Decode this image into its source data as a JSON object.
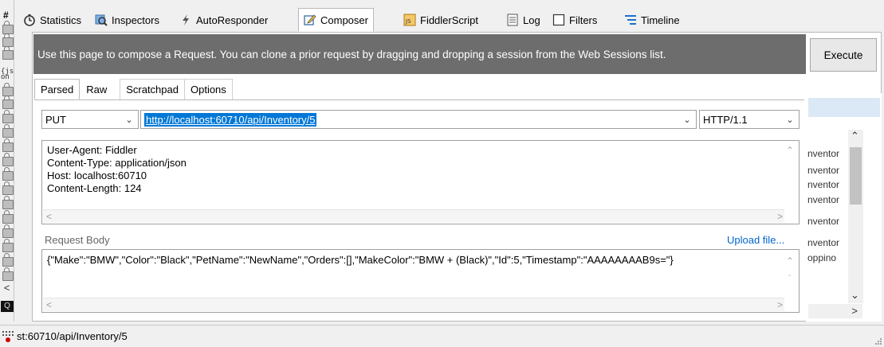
{
  "tabbar": {
    "hash": "#",
    "tabs": [
      {
        "label": "Statistics",
        "icon": "stopwatch-icon"
      },
      {
        "label": "Inspectors",
        "icon": "inspectors-icon"
      },
      {
        "label": "AutoResponder",
        "icon": "lightning-icon"
      },
      {
        "label": "Composer",
        "icon": "composer-pencil-icon",
        "active": true
      },
      {
        "label": "FiddlerScript",
        "icon": "js-script-icon"
      },
      {
        "label": "Log",
        "icon": "log-icon"
      },
      {
        "label": "Filters",
        "icon": "checkbox-icon"
      },
      {
        "label": "Timeline",
        "icon": "timeline-icon"
      }
    ]
  },
  "composer": {
    "banner": "Use this page to compose a Request. You can clone a prior request by dragging and dropping a session from the Web Sessions list.",
    "execute_label": "Execute",
    "subtabs": [
      "Parsed",
      "Raw",
      "Scratchpad",
      "Options"
    ],
    "method": "PUT",
    "url": "http://localhost:60710/api/Inventory/5",
    "http_version": "HTTP/1.1",
    "headers": [
      "User-Agent: Fiddler",
      "Content-Type: application/json",
      "Host: localhost:60710",
      "Content-Length: 124"
    ],
    "request_body_label": "Request Body",
    "upload_label": "Upload file...",
    "body": "{\"Make\":\"BMW\",\"Color\":\"Black\",\"PetName\":\"NewName\",\"Orders\":[],\"MakeColor\":\"BMW + (Black)\",\"Id\":5,\"Timestamp\":\"AAAAAAAAB9s=\"}"
  },
  "right_list": {
    "items": [
      "nventor",
      "nventor",
      "nventor",
      "nventor",
      "nventor",
      "nventor",
      "oppino"
    ]
  },
  "statusbar": {
    "text": "st:60710/api/Inventory/5"
  },
  "colors": {
    "banner_bg": "#6d6d6d",
    "url_highlight": "#0078d7",
    "link": "#0066cc"
  }
}
